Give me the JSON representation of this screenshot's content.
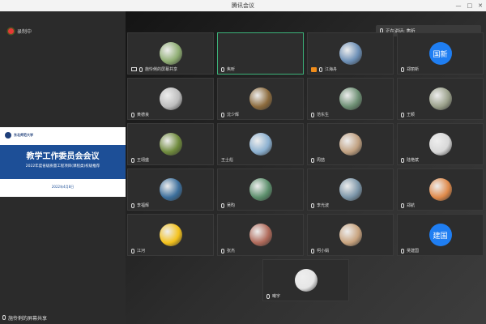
{
  "window": {
    "title": "腾讯会议",
    "controls": [
      "—",
      "□",
      "✕"
    ]
  },
  "recording": {
    "label": "录制中"
  },
  "slide": {
    "logo_text": "东北师范大学",
    "title": "教学工作委员会会议",
    "subtitle": "2022年度省级质量工程项目(课程类)校级推荐",
    "date": "2022年4月8日"
  },
  "share_footer": {
    "label": "施怜俐的屏幕共享"
  },
  "speaking": {
    "label": "正在讲话: 焦昕"
  },
  "participants": [
    {
      "name": "施怜俐的屏幕共享",
      "avatar_type": "photo",
      "avatar_color": "#8fae73",
      "icon": "screen"
    },
    {
      "name": "焦昕",
      "avatar_type": "none",
      "avatar_color": "#2d2d2d",
      "icon": "mic",
      "active": true
    },
    {
      "name": "江海舟",
      "avatar_type": "photo",
      "avatar_color": "#6c8fb6",
      "icon": "host"
    },
    {
      "name": "郑丽新",
      "avatar_type": "text",
      "avatar_text": "国新",
      "avatar_color": "#1f7ef2",
      "icon": "mic"
    },
    {
      "name": "黄德良",
      "avatar_type": "photo",
      "avatar_color": "#bdbdbd",
      "icon": "mic"
    },
    {
      "name": "沈少辉",
      "avatar_type": "photo",
      "avatar_color": "#8c6b3d",
      "icon": "mic"
    },
    {
      "name": "范东生",
      "avatar_type": "photo",
      "avatar_color": "#6d8f73",
      "icon": "mic"
    },
    {
      "name": "王颖",
      "avatar_type": "photo",
      "avatar_color": "#9aa08a",
      "icon": "mic"
    },
    {
      "name": "王翊盛",
      "avatar_type": "photo",
      "avatar_color": "#6f8a3c",
      "icon": "mic"
    },
    {
      "name": "王士彪",
      "avatar_type": "photo",
      "avatar_color": "#8bb0d0",
      "icon": "none"
    },
    {
      "name": "周喆",
      "avatar_type": "photo",
      "avatar_color": "#c0a080",
      "icon": "mic"
    },
    {
      "name": "陆艳斌",
      "avatar_type": "photo",
      "avatar_color": "#d8d8d8",
      "icon": "mic"
    },
    {
      "name": "李福辉",
      "avatar_type": "photo",
      "avatar_color": "#3c6f9c",
      "icon": "mic"
    },
    {
      "name": "吴昀",
      "avatar_type": "photo",
      "avatar_color": "#5c8f6c",
      "icon": "mic"
    },
    {
      "name": "李光波",
      "avatar_type": "photo",
      "avatar_color": "#7b95a8",
      "icon": "mic"
    },
    {
      "name": "郑航",
      "avatar_type": "photo",
      "avatar_color": "#e08a4a",
      "icon": "mic"
    },
    {
      "name": "江河",
      "avatar_type": "photo",
      "avatar_color": "#f4c21c",
      "icon": "mic"
    },
    {
      "name": "张杰",
      "avatar_type": "photo",
      "avatar_color": "#b06a5a",
      "icon": "mic"
    },
    {
      "name": "柯小娟",
      "avatar_type": "photo",
      "avatar_color": "#c8a37e",
      "icon": "mic"
    },
    {
      "name": "吴建国",
      "avatar_type": "text",
      "avatar_text": "建国",
      "avatar_color": "#1f7ef2",
      "icon": "mic"
    },
    {
      "name": "曦宇",
      "avatar_type": "photo",
      "avatar_color": "#e6e6e6",
      "icon": "mic"
    }
  ]
}
